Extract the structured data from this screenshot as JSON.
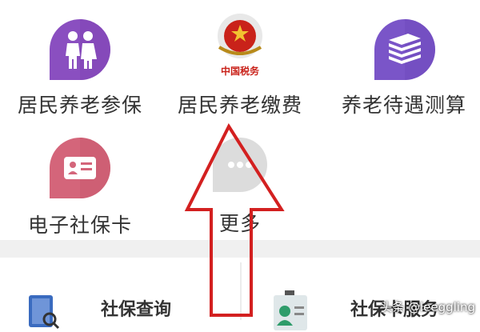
{
  "tiles": [
    {
      "label": "居民养老参保",
      "icon": "elderly-couple-icon",
      "color": "#8a4fc0"
    },
    {
      "label": "居民养老缴费",
      "icon": "tax-emblem-icon",
      "color": "#c9221a",
      "emblem_text": "中国税务"
    },
    {
      "label": "养老待遇测算",
      "icon": "books-stack-icon",
      "color": "#7a55c8"
    },
    {
      "label": "电子社保卡",
      "icon": "id-card-icon",
      "color": "#d4657a"
    },
    {
      "label": "更多",
      "icon": "more-dots-icon",
      "color": "#dcdcdc"
    }
  ],
  "bottom": {
    "left_label": "社保查询",
    "right_label": "社保卡服务"
  },
  "annotation": {
    "arrow_color": "#d32020"
  },
  "watermark": "头条 @leeggling"
}
